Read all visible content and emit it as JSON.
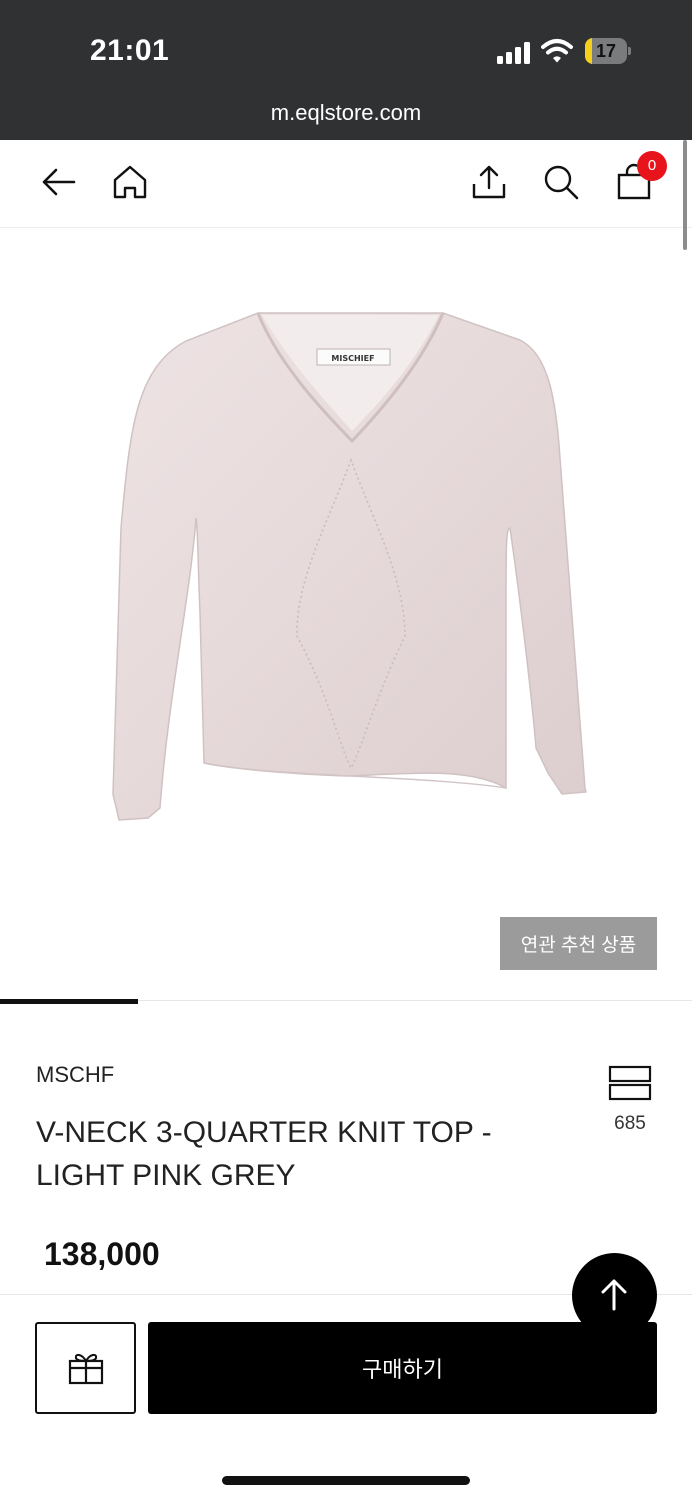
{
  "status_bar": {
    "time": "21:01",
    "battery_level": "17",
    "battery_color": "#f4d01a",
    "url": "m.eqlstore.com"
  },
  "nav": {
    "icons": [
      "back-arrow-icon",
      "home-icon",
      "share-icon",
      "search-icon",
      "shopping-bag-icon"
    ],
    "cart_count": "0",
    "badge_color": "#e8141b"
  },
  "product": {
    "image_icon": "knit-top-product-image",
    "related_button_label": "연관 추천 상품",
    "gallery_progress": 0.2,
    "brand": "MSCHF",
    "title": "V-NECK 3-QUARTER KNIT TOP - LIGHT PINK GREY",
    "price": "138,000",
    "like_icon": "wishlist-stack-icon",
    "like_count": "685",
    "label_text": "MISCHIEF"
  },
  "actions": {
    "gift_icon": "gift-icon",
    "buy_label": "구매하기",
    "top_icon": "arrow-up-icon"
  }
}
